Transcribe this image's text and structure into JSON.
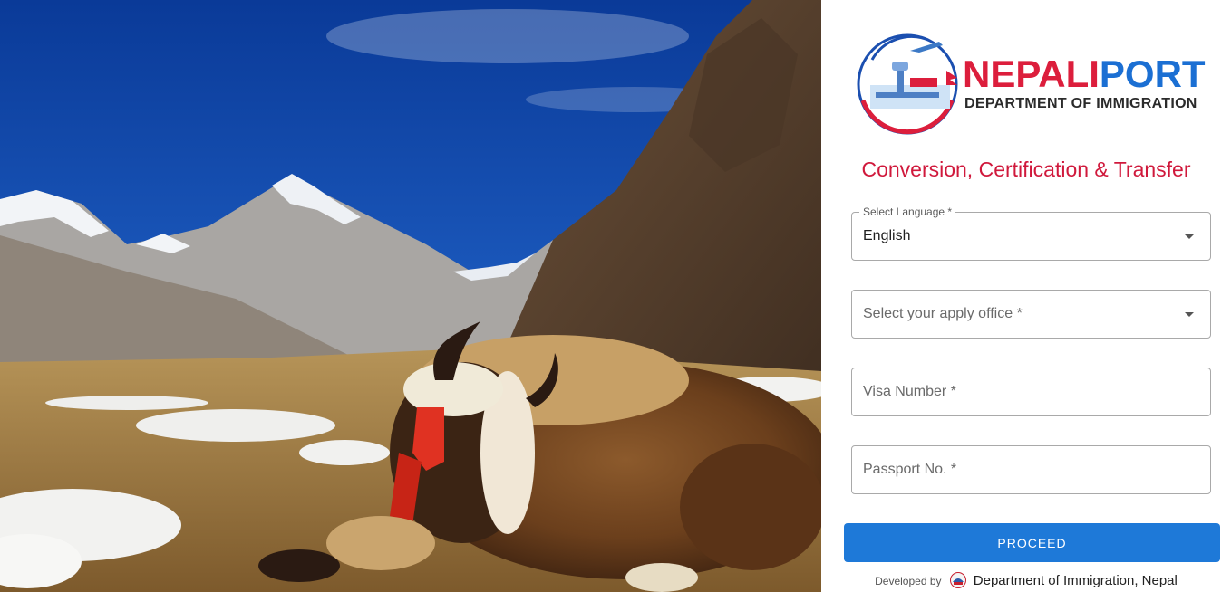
{
  "brand": {
    "name_part1": "NEPALI",
    "name_part2": "PORT",
    "department": "DEPARTMENT OF IMMIGRATION"
  },
  "form": {
    "title": "Conversion, Certification & Transfer",
    "language": {
      "label": "Select Language *",
      "value": "English"
    },
    "office": {
      "placeholder": "Select your apply office *"
    },
    "visa": {
      "placeholder": "Visa Number *"
    },
    "passport": {
      "placeholder": "Passport No. *"
    },
    "submit_label": "PROCEED"
  },
  "footer": {
    "developed_by": "Developed by",
    "organization": "Department of Immigration, Nepal"
  },
  "colors": {
    "brand_red": "#dc1e3c",
    "brand_blue": "#1b6fd3",
    "button_blue": "#1e79d8"
  },
  "icons": [
    "nepaliport-logo",
    "chevron-down-icon",
    "nepal-emblem-icon"
  ]
}
